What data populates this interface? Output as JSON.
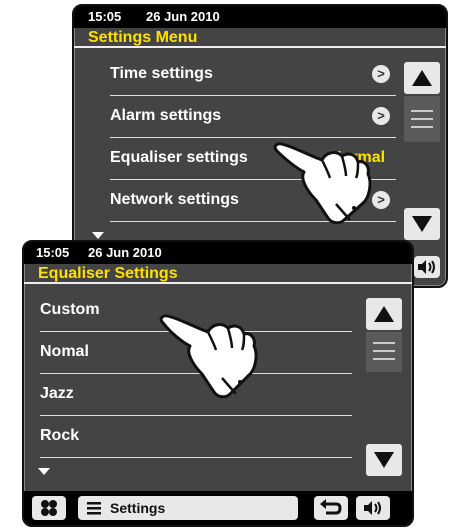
{
  "back_screen": {
    "time": "15:05",
    "date": "26 Jun 2010",
    "title": "Settings Menu",
    "items": [
      {
        "label": "Time settings",
        "value": ""
      },
      {
        "label": "Alarm settings",
        "value": ""
      },
      {
        "label": "Equaliser settings",
        "value": "Normal"
      },
      {
        "label": "Network settings",
        "value": ""
      }
    ],
    "chevron": ">"
  },
  "front_screen": {
    "time": "15:05",
    "date": "26 Jun 2010",
    "title": "Equaliser Settings",
    "items": [
      {
        "label": "Custom"
      },
      {
        "label": "Nomal"
      },
      {
        "label": "Jazz"
      },
      {
        "label": "Rock"
      }
    ],
    "toolbar": {
      "menu_label": "Settings"
    }
  },
  "colors": {
    "screen_bg": "#444444",
    "heading": "#ffe000",
    "status_bar": "#000000"
  }
}
